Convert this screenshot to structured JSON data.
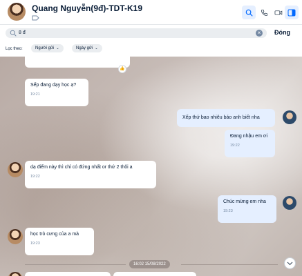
{
  "header": {
    "contact_name": "Quang Nguyễn(9đ)-TDT-K19",
    "icons": [
      "search-icon",
      "phone-icon",
      "video-call-icon",
      "sidebar-toggle-icon"
    ],
    "accent_color": "#0068ff"
  },
  "search": {
    "value": "8 đ",
    "close_label": "Đóng"
  },
  "filters": {
    "label": "Lọc theo:",
    "sender_chip": "Người gửi",
    "date_chip": "Ngày gửi"
  },
  "messages": [
    {
      "side": "left",
      "text": "Sếp đang dạy học ạ?",
      "time": "19:21"
    },
    {
      "side": "right",
      "text": "Xếp thứ bao nhiêu báo anh biết nha",
      "time": ""
    },
    {
      "side": "right",
      "text": "Đang nhậu em ơi",
      "time": "19:22"
    },
    {
      "side": "left",
      "text": "dạ điểm này thì chỉ có đứng nhất or thứ 2 thôi a",
      "time": "19:22"
    },
    {
      "side": "right",
      "text": "Chúc mừng em nha",
      "time": "19:23"
    },
    {
      "side": "left",
      "text": "học trò cưng của a mà",
      "time": "19:23"
    }
  ],
  "date_divider": "16:02 15/08/2022"
}
